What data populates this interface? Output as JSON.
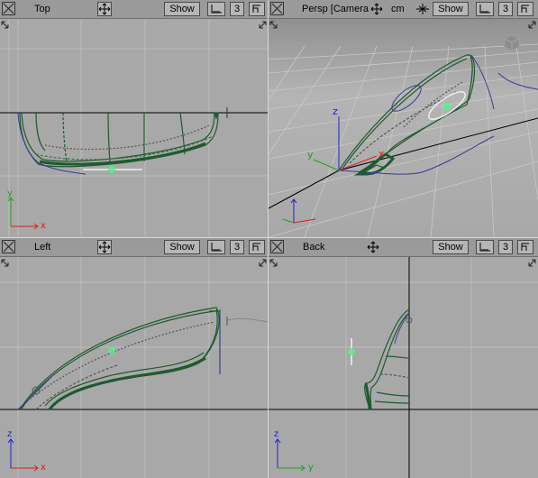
{
  "viewports": {
    "top": {
      "title": "Top",
      "show_label": "Show",
      "count_label": "3"
    },
    "persp": {
      "title": "Persp [Camera",
      "unit_label": "cm",
      "show_label": "Show",
      "count_label": "3"
    },
    "left": {
      "title": "Left",
      "show_label": "Show",
      "count_label": "3"
    },
    "back": {
      "title": "Back",
      "show_label": "Show",
      "count_label": "3"
    }
  },
  "axes": {
    "x": "x",
    "y": "y",
    "z": "z"
  },
  "colors": {
    "viewport_bg": "#a8a8a8",
    "curve_green": "#1e5a2e",
    "construction_blue": "#3a3a9c",
    "axis_red": "#d42020",
    "axis_green": "#20a020",
    "axis_blue": "#2020d0",
    "pivot": "#40ff80"
  },
  "icons": [
    "close-icon",
    "move-arrows-icon",
    "ruler-icon",
    "maximize-icon",
    "resize-corner-icon",
    "camera-cube-icon"
  ]
}
